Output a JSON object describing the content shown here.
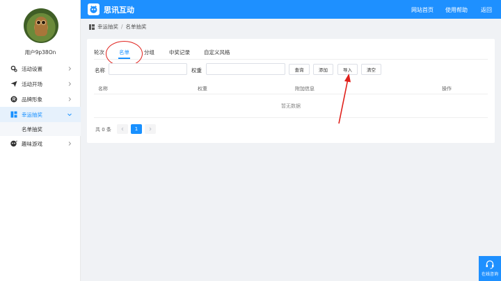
{
  "sidebar": {
    "username": "用户9p38On",
    "items": [
      {
        "label": "活动设置",
        "icon": "gear-icon"
      },
      {
        "label": "活动开场",
        "icon": "paper-plane-icon"
      },
      {
        "label": "品牌形象",
        "icon": "registered-icon"
      },
      {
        "label": "幸运抽奖",
        "icon": "grid-icon"
      },
      {
        "label": "趣味游戏",
        "icon": "gamepad-icon"
      }
    ],
    "sub_item": "名单抽奖"
  },
  "topbar": {
    "brand": "思讯互动",
    "links": [
      "网站首页",
      "使用帮助",
      "返回"
    ]
  },
  "breadcrumb": {
    "items": [
      "幸运抽奖",
      "名单抽奖"
    ],
    "separator": "/"
  },
  "tabs": [
    "轮次",
    "名单",
    "分组",
    "中奖记录",
    "自定义风格"
  ],
  "active_tab": "名单",
  "filters": {
    "name_label": "名称",
    "name_value": "",
    "weight_label": "权重",
    "weight_value": ""
  },
  "buttons": {
    "search": "查询",
    "add": "添加",
    "import": "导入",
    "clear": "清空"
  },
  "table": {
    "columns": [
      "名称",
      "权重",
      "附加信息",
      "操作"
    ],
    "empty_text": "暂无数据"
  },
  "pagination": {
    "total_text": "共 0 条",
    "current_page": "1"
  },
  "help": {
    "label": "在线咨询"
  },
  "colors": {
    "primary": "#1e90ff",
    "annotation": "#e0201b"
  }
}
